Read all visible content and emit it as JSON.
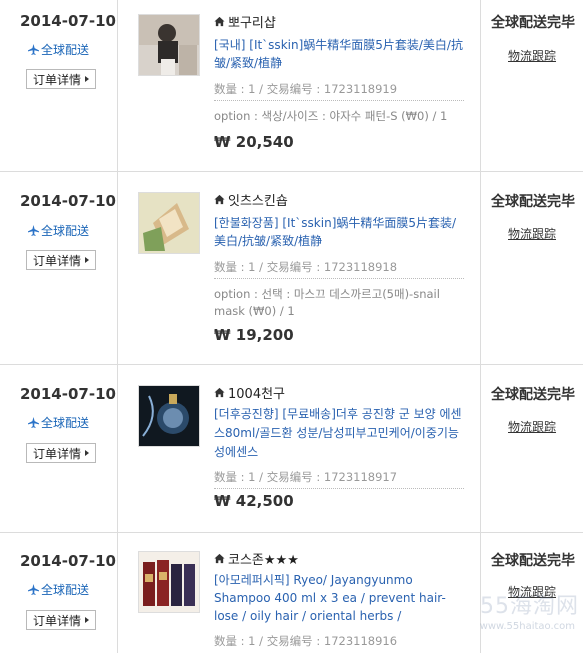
{
  "orders": [
    {
      "date": "2014-07-10",
      "ship_type": "全球配送",
      "detail_label": "订单详情",
      "seller": "뽀구리샵",
      "product": "[국내] [It`sskin]蜗牛精华面膜5片套装/美白/抗皱/紧致/植静",
      "meta": "数量 : 1 / 交易编号 : 1723118919",
      "option": "option : 색상/사이즈 : 야자수 패턴-S (₩0) / 1",
      "price": "₩ 20,540",
      "status": "全球配送完毕",
      "track_label": "物流跟踪"
    },
    {
      "date": "2014-07-10",
      "ship_type": "全球配送",
      "detail_label": "订单详情",
      "seller": "잇츠스킨숍",
      "product": "[한불화장품] [It`sskin]蜗牛精华面膜5片套装/美白/抗皱/紧致/植静",
      "meta": "数量 : 1 / 交易编号 : 1723118918",
      "option": "option : 선택 : 마스끄 데스까르고(5매)-snail mask (₩0) / 1",
      "price": "₩ 19,200",
      "status": "全球配送完毕",
      "track_label": "物流跟踪"
    },
    {
      "date": "2014-07-10",
      "ship_type": "全球配送",
      "detail_label": "订单详情",
      "seller": "1004천구",
      "product": "[더후공진향] [무료배송]더후 공진향 군 보양 에센스80ml/골드환 성분/남성피부고민케어/이중기능성에센스",
      "meta": "数量 : 1 / 交易编号 : 1723118917",
      "option": "",
      "price": "₩ 42,500",
      "status": "全球配送完毕",
      "track_label": "物流跟踪"
    },
    {
      "date": "2014-07-10",
      "ship_type": "全球配送",
      "detail_label": "订单详情",
      "seller": "코스존★★★",
      "product": "[아모레퍼시픽] Ryeo/ Jayangyunmo Shampoo 400 ml x 3 ea / prevent hair-lose / oily hair / oriental herbs /",
      "meta": "数量 : 1 / 交易编号 : 1723118916",
      "option": "",
      "price": "",
      "status": "全球配送完毕",
      "track_label": "物流跟踪"
    }
  ],
  "watermark": {
    "text": "55海淘网",
    "url": "www.55haitao.com"
  }
}
